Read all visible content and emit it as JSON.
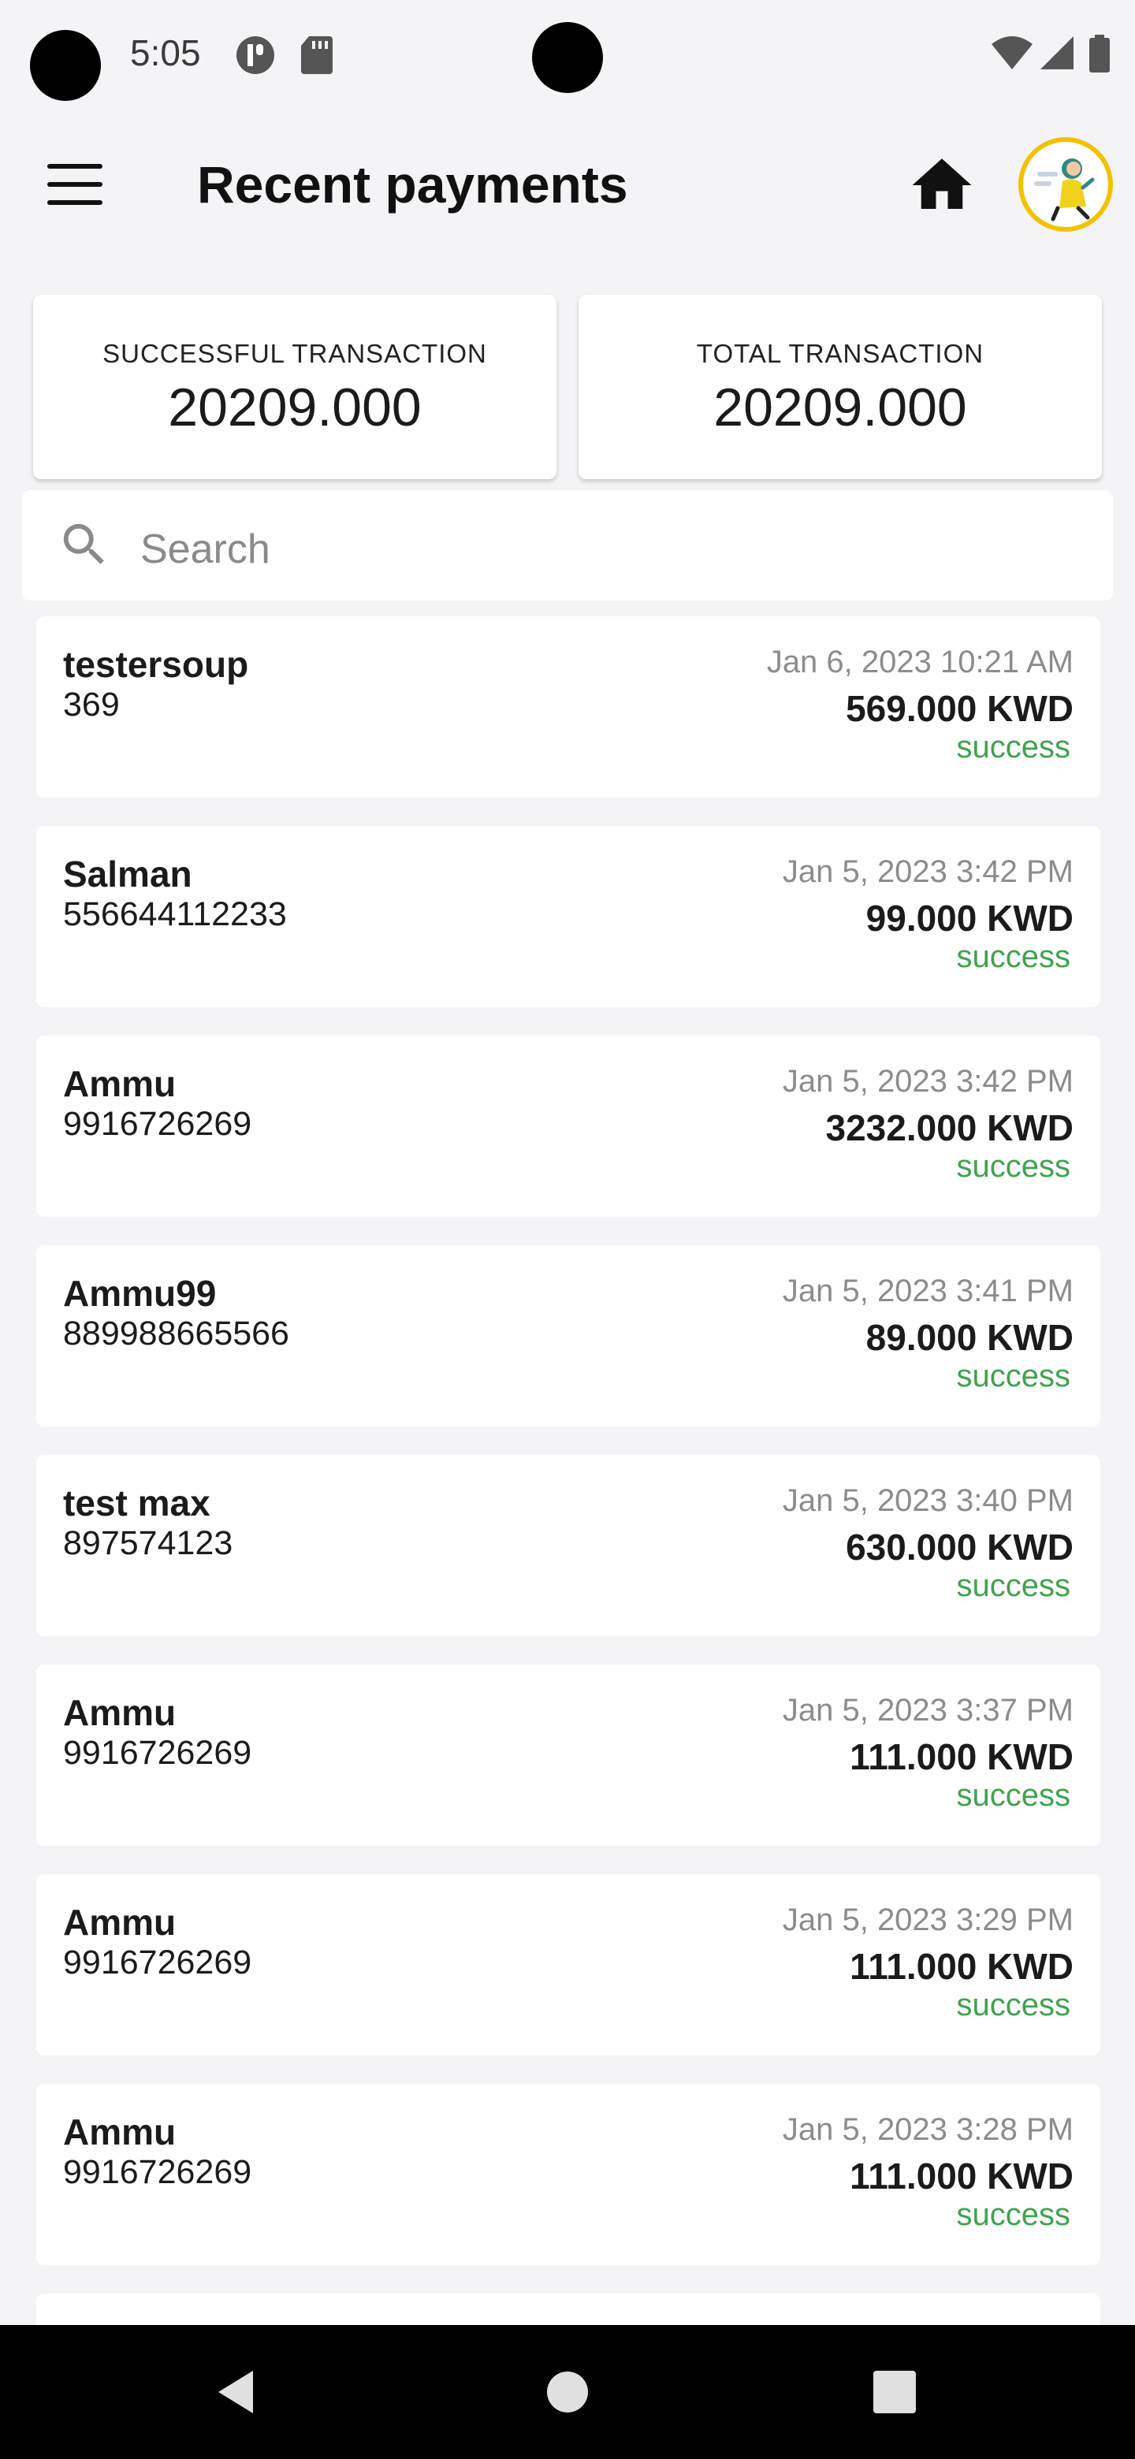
{
  "status_bar": {
    "time": "5:05"
  },
  "header": {
    "title": "Recent payments"
  },
  "summary": [
    {
      "label": "SUCCESSFUL TRANSACTION",
      "value": "20209.000"
    },
    {
      "label": "TOTAL TRANSACTION",
      "value": "20209.000"
    }
  ],
  "search": {
    "placeholder": "Search"
  },
  "payments": [
    {
      "name": "testersoup",
      "phone": "369",
      "date": "Jan 6, 2023 10:21 AM",
      "amount": "569.000 KWD",
      "status": "success"
    },
    {
      "name": "Salman",
      "phone": "556644112233",
      "date": "Jan 5, 2023 3:42 PM",
      "amount": "99.000 KWD",
      "status": "success"
    },
    {
      "name": "Ammu",
      "phone": "9916726269",
      "date": "Jan 5, 2023 3:42 PM",
      "amount": "3232.000 KWD",
      "status": "success"
    },
    {
      "name": "Ammu99",
      "phone": "889988665566",
      "date": "Jan 5, 2023 3:41 PM",
      "amount": "89.000 KWD",
      "status": "success"
    },
    {
      "name": "test max",
      "phone": "897574123",
      "date": "Jan 5, 2023 3:40 PM",
      "amount": "630.000 KWD",
      "status": "success"
    },
    {
      "name": "Ammu",
      "phone": "9916726269",
      "date": "Jan 5, 2023 3:37 PM",
      "amount": "111.000 KWD",
      "status": "success"
    },
    {
      "name": "Ammu",
      "phone": "9916726269",
      "date": "Jan 5, 2023 3:29 PM",
      "amount": "111.000 KWD",
      "status": "success"
    },
    {
      "name": "Ammu",
      "phone": "9916726269",
      "date": "Jan 5, 2023 3:28 PM",
      "amount": "111.000 KWD",
      "status": "success"
    }
  ],
  "colors": {
    "success": "#3fa34d",
    "avatar_ring": "#f2c200"
  }
}
